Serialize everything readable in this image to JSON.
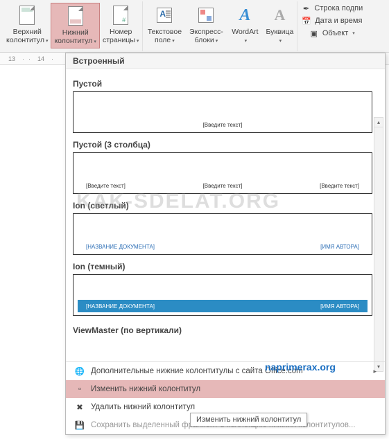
{
  "ribbon": {
    "header_top": {
      "label1": "Верхний",
      "label2": "колонтитул"
    },
    "footer": {
      "label1": "Нижний",
      "label2": "колонтитул"
    },
    "pagenum": {
      "label1": "Номер",
      "label2": "страницы"
    },
    "textbox": {
      "label1": "Текстовое",
      "label2": "поле"
    },
    "express": {
      "label1": "Экспресс-",
      "label2": "блоки"
    },
    "wordart": {
      "label1": "WordArt",
      "label2": ""
    },
    "dropcap": {
      "label1": "Буквица",
      "label2": ""
    },
    "side": {
      "signature": "Строка подпи",
      "datetime": "Дата и время",
      "object": "Объект"
    }
  },
  "ruler": {
    "t13": "13",
    "t14": "14"
  },
  "gallery": {
    "header": "Встроенный",
    "sections": {
      "empty": {
        "title": "Пустой",
        "ph": "[Введите текст]"
      },
      "empty3": {
        "title": "Пустой (3 столбца)",
        "ph1": "[Введите текст]",
        "ph2": "[Введите текст]",
        "ph3": "[Введите текст]"
      },
      "ion_light": {
        "title": "Ion (светлый)",
        "doc": "[НАЗВАНИЕ ДОКУМЕНТА]",
        "author": "[ИМЯ АВТОРА]"
      },
      "ion_dark": {
        "title": "Ion (темный)",
        "doc": "[НАЗВАНИЕ ДОКУМЕНТА]",
        "author": "[ИМЯ АВТОРА]"
      },
      "viewmaster": {
        "title": "ViewMaster (по вертикали)"
      }
    },
    "menu": {
      "more": "Дополнительные нижние колонтитулы с сайта Office.com",
      "edit": "Изменить нижний колонтитул",
      "remove": "Удалить нижний колонтитул",
      "save": "Сохранить выделенный фрагмент в коллекцию нижних колонтитулов..."
    },
    "tooltip": "Изменить нижний колонтитул"
  },
  "watermark": "KAK-SDELAT.ORG",
  "watermark2": "naprimerax.org"
}
